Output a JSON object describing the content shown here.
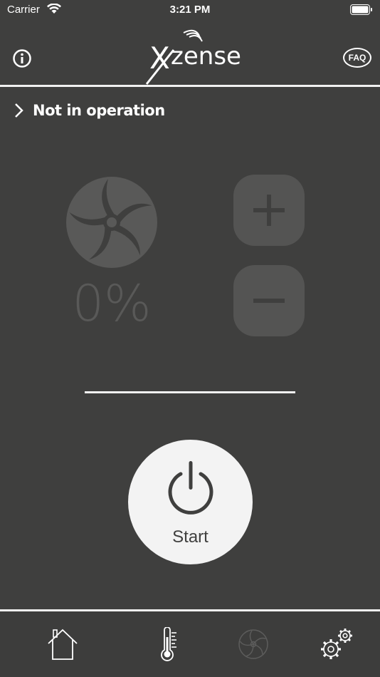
{
  "status_bar": {
    "carrier": "Carrier",
    "time": "3:21 PM"
  },
  "header": {
    "logo_text": "zense",
    "logo_initial": "X",
    "faq_label": "FAQ",
    "info_icon": "info-icon"
  },
  "operation": {
    "status_text": "Not in operation"
  },
  "fan": {
    "speed_percent": "0%"
  },
  "controls": {
    "plus_icon": "plus-icon",
    "minus_icon": "minus-icon"
  },
  "start": {
    "label": "Start"
  },
  "tabs": [
    {
      "name": "home",
      "icon": "home-icon"
    },
    {
      "name": "temperature",
      "icon": "thermometer-icon"
    },
    {
      "name": "fan",
      "icon": "fan-icon"
    },
    {
      "name": "settings",
      "icon": "gears-icon"
    }
  ],
  "colors": {
    "background": "#3f3f3e",
    "foreground": "#ffffff",
    "disabled": "#595958",
    "button_bg": "#545453",
    "start_bg": "#f3f3f3"
  }
}
